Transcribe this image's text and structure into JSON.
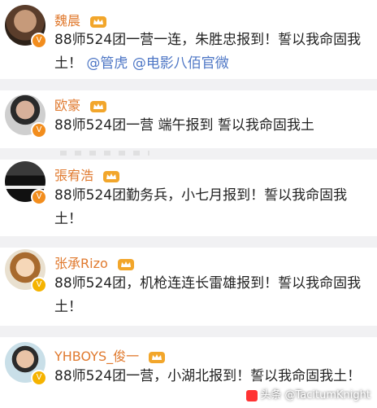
{
  "posts": [
    {
      "name": "魏晨",
      "content": "88师524团一营一连，朱胜忠报到！誓以我命固我土！",
      "mentions": [
        "@管虎",
        "@电影八佰官微"
      ]
    },
    {
      "name": "欧豪",
      "content": "88师524团一营 端午报到 誓以我命固我土"
    },
    {
      "name": "張宥浩",
      "content": "88师524团勤务兵，小七月报到！誓以我命固我土！"
    },
    {
      "name": "张承Rizo",
      "content": "88师524团，机枪连连长雷雄报到！誓以我命固我土！"
    },
    {
      "name": "YHBOYS_俊一",
      "content": "88师524团一营，小湖北报到！誓以我命固我土！"
    }
  ],
  "watermark": "头条 @TacitumKnight",
  "colors": {
    "name": "#e07a2f",
    "mention": "#4d76c5",
    "separator": "#f1f1f3",
    "verify_orange": "#f28d1d",
    "verify_yellow": "#f5b300"
  }
}
